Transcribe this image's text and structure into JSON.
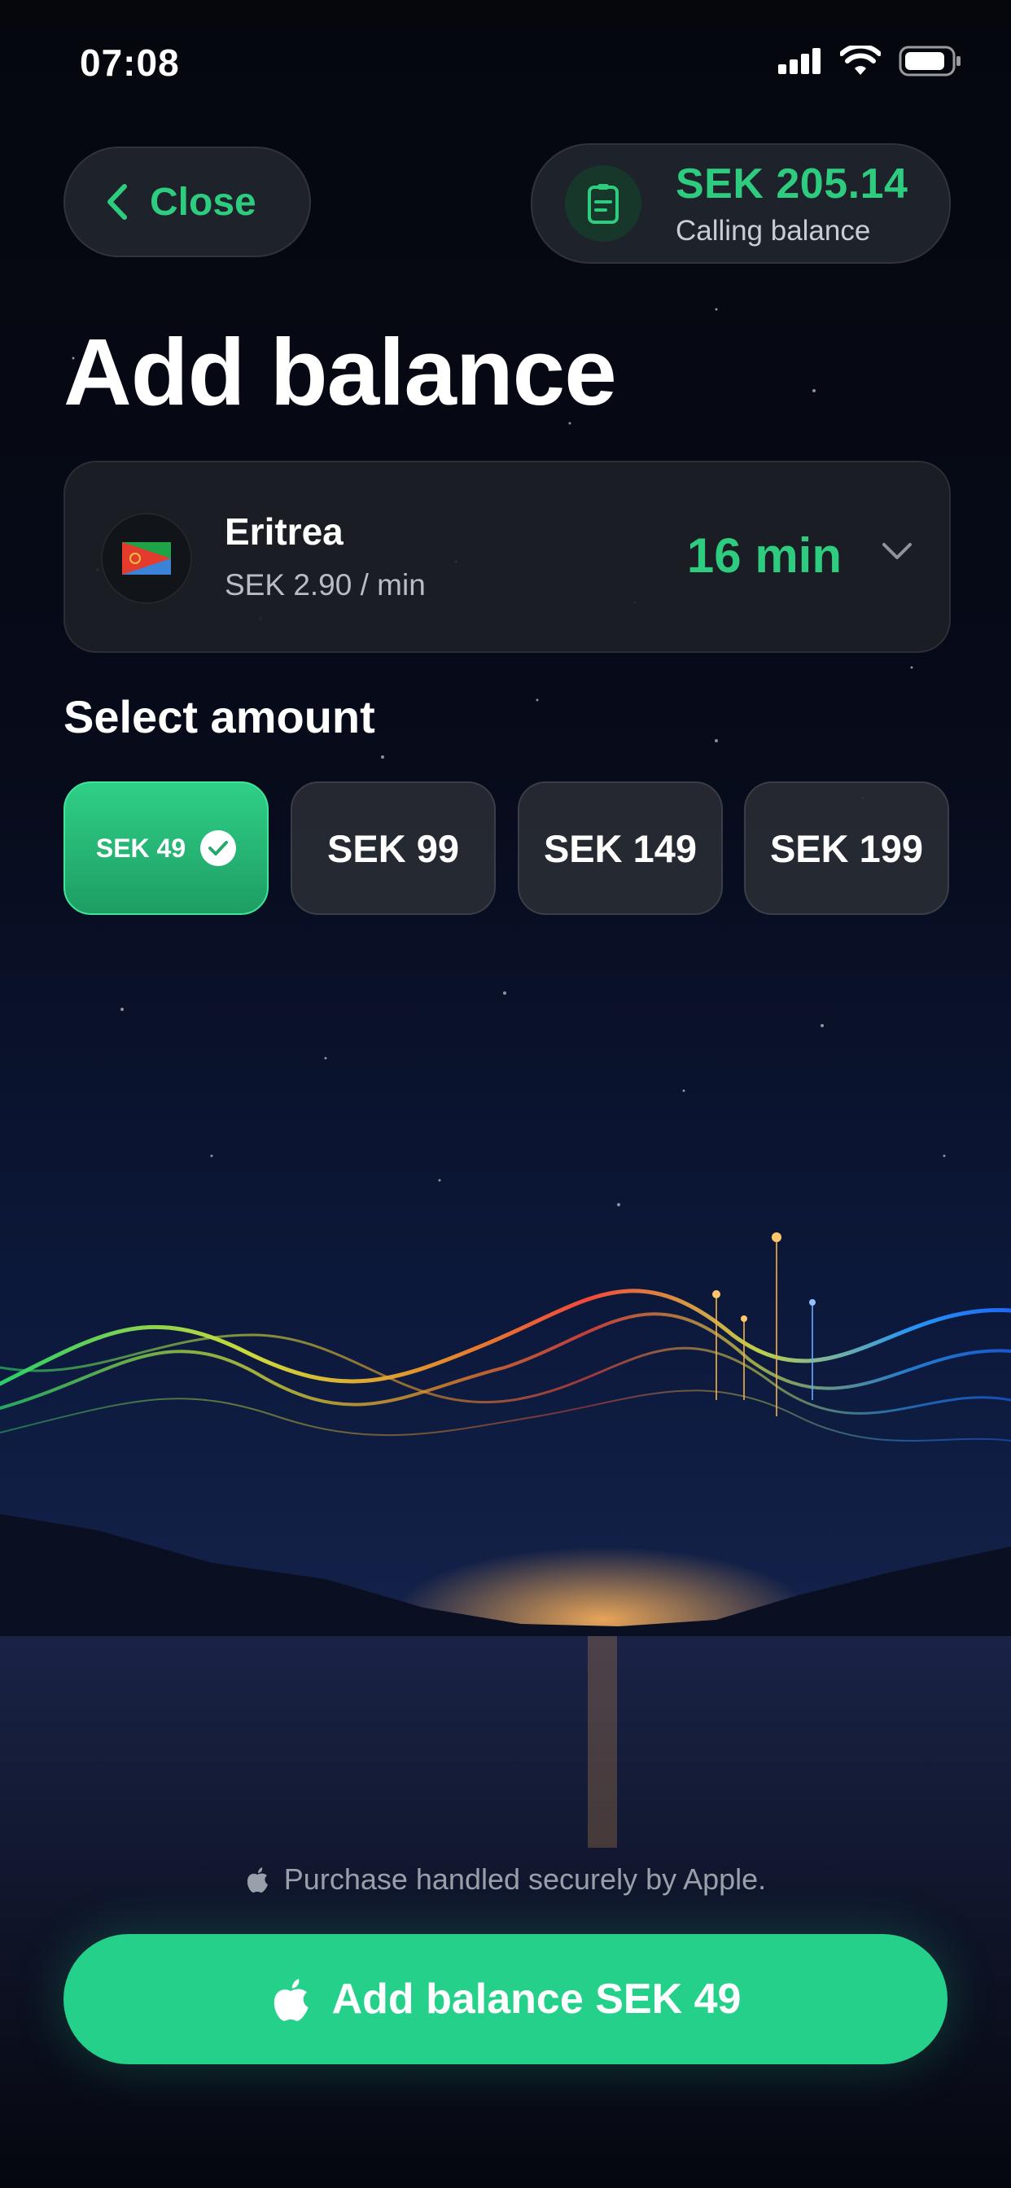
{
  "status_bar": {
    "time": "07:08"
  },
  "header": {
    "close_label": "Close",
    "balance_amount": "SEK 205.14",
    "balance_caption": "Calling balance"
  },
  "title": "Add balance",
  "destination": {
    "country": "Eritrea",
    "rate": "SEK 2.90 / min",
    "minutes": "16 min",
    "flag_icon": "eritrea-flag"
  },
  "amount_section": {
    "label": "Select amount",
    "options": [
      {
        "label": "SEK 49",
        "selected": true
      },
      {
        "label": "SEK 99",
        "selected": false
      },
      {
        "label": "SEK 149",
        "selected": false
      },
      {
        "label": "SEK 199",
        "selected": false
      }
    ]
  },
  "footer": {
    "secure_note": "Purchase handled securely by Apple.",
    "cta_label": "Add balance SEK 49"
  },
  "colors": {
    "accent": "#2ecc7f",
    "cta": "#25d18a",
    "background": "#05070f"
  }
}
